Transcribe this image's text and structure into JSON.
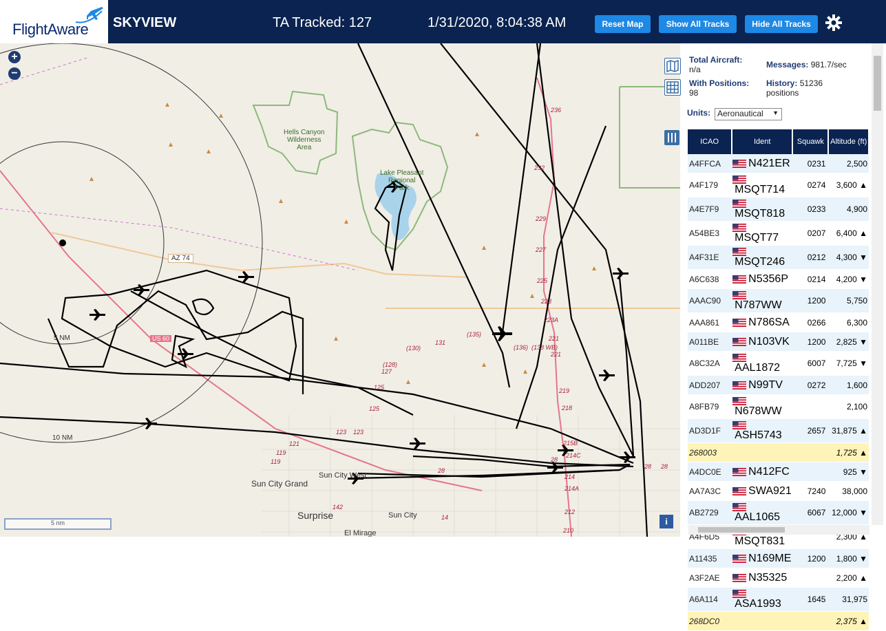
{
  "header": {
    "logo_text": "FlightAware",
    "app_name": "SKYVIEW",
    "tracked": "TA Tracked: 127",
    "datetime": "1/31/2020, 8:04:38 AM",
    "buttons": [
      "Reset Map",
      "Show All Tracks",
      "Hide All Tracks"
    ],
    "settings_icon": "gear-icon"
  },
  "map": {
    "zoom_in": "+",
    "zoom_out": "−",
    "scale": "5 nm",
    "info": "i",
    "labels": {
      "wilderness": "Hells Canyon\nWilderness\nArea",
      "lake": "Lake Pleasant\nRegional\nPark",
      "az74": "AZ 74",
      "us60": "US 60",
      "ring5": "5 NM",
      "ring10": "10 NM",
      "sun_city_grand": "Sun City Grand",
      "sun_city_west": "Sun City West",
      "surprise": "Surprise",
      "sun_city": "Sun City",
      "el_mirage": "El Mirage",
      "altitudes": [
        "236",
        "232",
        "229",
        "227",
        "225",
        "223",
        "223A",
        "221",
        "221",
        "219",
        "218",
        "215B",
        "214C",
        "214",
        "214A",
        "212",
        "210",
        "131",
        "(130)",
        "(135)",
        "(136)",
        "(138 WB)",
        "(128)",
        "127",
        "125",
        "125",
        "123",
        "123",
        "121",
        "119",
        "119",
        "142",
        "14",
        "28",
        "28",
        "28",
        "28"
      ]
    }
  },
  "side": {
    "icons": [
      "map-layers-icon",
      "grid-icon",
      "columns-icon"
    ],
    "stats": {
      "total_label": "Total Aircraft:",
      "total_value": "n/a",
      "messages_label": "Messages:",
      "messages_value": "981.7/sec",
      "positions_label": "With Positions:",
      "positions_value": "98",
      "history_label": "History:",
      "history_value": "51236",
      "history_unit": "positions"
    },
    "units_label": "Units:",
    "units_value": "Aeronautical",
    "columns": [
      "ICAO",
      "Ident",
      "Squawk",
      "Altitude (ft)"
    ],
    "rows": [
      {
        "icao": "A4FFCA",
        "ident": "N421ER",
        "squawk": "0231",
        "alt": "2,500",
        "trend": ""
      },
      {
        "icao": "A4F179",
        "ident": "MSQT714",
        "squawk": "0274",
        "alt": "3,600",
        "trend": "▲"
      },
      {
        "icao": "A4E7F9",
        "ident": "MSQT818",
        "squawk": "0233",
        "alt": "4,900",
        "trend": ""
      },
      {
        "icao": "A54BE3",
        "ident": "MSQT77",
        "squawk": "0207",
        "alt": "6,400",
        "trend": "▲"
      },
      {
        "icao": "A4F31E",
        "ident": "MSQT246",
        "squawk": "0212",
        "alt": "4,300",
        "trend": "▼"
      },
      {
        "icao": "A6C638",
        "ident": "N5356P",
        "squawk": "0214",
        "alt": "4,200",
        "trend": "▼"
      },
      {
        "icao": "AAAC90",
        "ident": "N787WW",
        "squawk": "1200",
        "alt": "5,750",
        "trend": ""
      },
      {
        "icao": "AAA861",
        "ident": "N786SA",
        "squawk": "0266",
        "alt": "6,300",
        "trend": ""
      },
      {
        "icao": "A011BE",
        "ident": "N103VK",
        "squawk": "1200",
        "alt": "2,825",
        "trend": "▼"
      },
      {
        "icao": "A8C32A",
        "ident": "AAL1872",
        "squawk": "6007",
        "alt": "7,725",
        "trend": "▼"
      },
      {
        "icao": "ADD207",
        "ident": "N99TV",
        "squawk": "0272",
        "alt": "1,600",
        "trend": ""
      },
      {
        "icao": "A8FB79",
        "ident": "N678WW",
        "squawk": "",
        "alt": "2,100",
        "trend": ""
      },
      {
        "icao": "AD3D1F",
        "ident": "ASH5743",
        "squawk": "2657",
        "alt": "31,875",
        "trend": "▲"
      },
      {
        "icao": "268003",
        "ident": "",
        "squawk": "",
        "alt": "1,725",
        "trend": "▲",
        "highlight": true
      },
      {
        "icao": "A4DC0E",
        "ident": "N412FC",
        "squawk": "",
        "alt": "925",
        "trend": "▼"
      },
      {
        "icao": "AA7A3C",
        "ident": "SWA921",
        "squawk": "7240",
        "alt": "38,000",
        "trend": ""
      },
      {
        "icao": "AB2729",
        "ident": "AAL1065",
        "squawk": "6067",
        "alt": "12,000",
        "trend": "▼"
      },
      {
        "icao": "A4F6D5",
        "ident": "MSQT831",
        "squawk": "",
        "alt": "2,300",
        "trend": "▲"
      },
      {
        "icao": "A11435",
        "ident": "N169ME",
        "squawk": "1200",
        "alt": "1,800",
        "trend": "▼"
      },
      {
        "icao": "A3F2AE",
        "ident": "N35325",
        "squawk": "",
        "alt": "2,200",
        "trend": "▲"
      },
      {
        "icao": "A6A114",
        "ident": "ASA1993",
        "squawk": "1645",
        "alt": "31,975",
        "trend": ""
      },
      {
        "icao": "268DC0",
        "ident": "",
        "squawk": "",
        "alt": "2,375",
        "trend": "▲",
        "highlight": true
      }
    ]
  },
  "colors": {
    "header_bg": "#0a2350",
    "button_bg": "#1e88e5",
    "row_alt": "#e8f3fb",
    "row_highlight": "#fff4b8",
    "map_bg": "#f1eee6",
    "park_green": "#8cb87a",
    "water": "#a9d3ea",
    "route_red": "#e5758a"
  }
}
